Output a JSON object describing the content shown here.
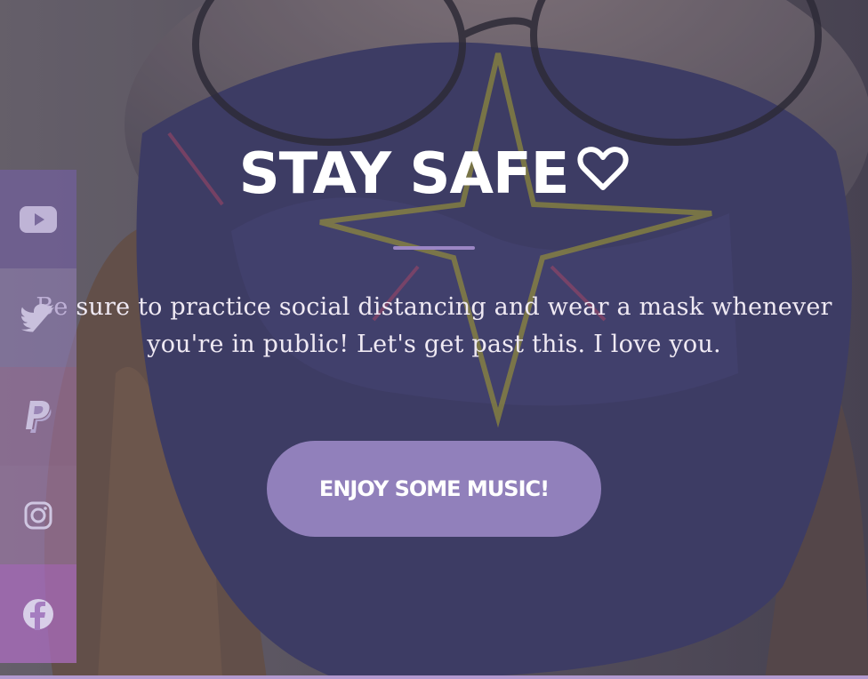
{
  "hero": {
    "title": "STAY SAFE",
    "heart_icon": "heart-outline-icon",
    "subtitle": "Be sure to practice social distancing and wear a mask whenever you're in public! Let's get past this. I love you.",
    "cta_label": "ENJOY SOME MUSIC!"
  },
  "social": {
    "items": [
      {
        "name": "YouTube",
        "icon": "youtube-icon"
      },
      {
        "name": "Twitter",
        "icon": "twitter-icon"
      },
      {
        "name": "PayPal",
        "icon": "paypal-icon"
      },
      {
        "name": "Instagram",
        "icon": "instagram-icon"
      },
      {
        "name": "Facebook",
        "icon": "facebook-icon"
      }
    ]
  },
  "colors": {
    "accent": "#9180bb",
    "divider": "#9b86c4",
    "title_text": "#ffffff",
    "subtitle_text": "#efe9f3"
  }
}
